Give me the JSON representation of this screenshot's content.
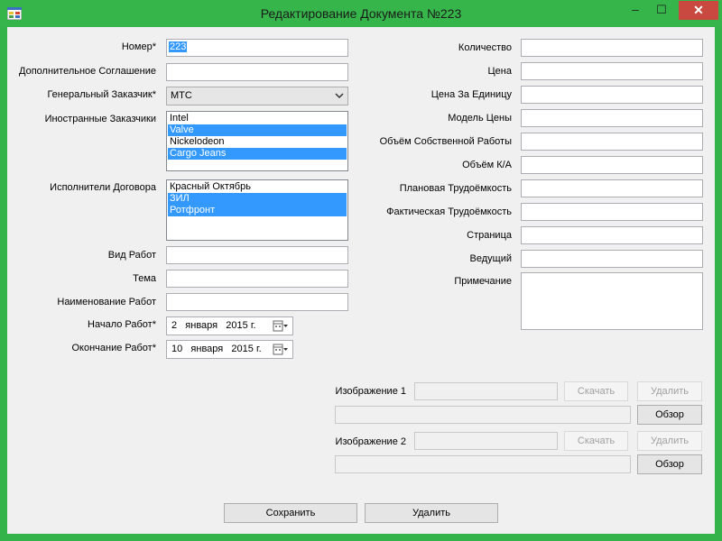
{
  "window": {
    "title": "Редактирование Документа №223",
    "controls": {
      "minimize": "–",
      "maximize": "☐",
      "close": "✕"
    }
  },
  "left_form": {
    "nomer": {
      "label": "Номер*",
      "value": "223"
    },
    "dop_soglashenie": {
      "label": "Дополнительное Соглашение",
      "value": ""
    },
    "gen_zakazchik": {
      "label": "Генеральный Заказчик*",
      "value": "МТС"
    },
    "inostr_zakazchiki": {
      "label": "Иностранные Заказчики",
      "items": [
        {
          "text": "Intel",
          "selected": false
        },
        {
          "text": "Valve",
          "selected": true
        },
        {
          "text": "Nickelodeon",
          "selected": false
        },
        {
          "text": "Cargo Jeans",
          "selected": true
        }
      ]
    },
    "ispolniteli": {
      "label": "Исполнители Договора",
      "items": [
        {
          "text": "Красный Октябрь",
          "selected": false
        },
        {
          "text": "ЗИЛ",
          "selected": true
        },
        {
          "text": "Ротфронт",
          "selected": true
        }
      ]
    },
    "vid_rabot": {
      "label": "Вид Работ",
      "value": ""
    },
    "tema": {
      "label": "Тема",
      "value": ""
    },
    "naimenovanie": {
      "label": "Наименование Работ",
      "value": ""
    },
    "nachalo": {
      "label": "Начало Работ*",
      "day": "2",
      "month": "января",
      "year": "2015 г."
    },
    "okonchanie": {
      "label": "Окончание Работ*",
      "day": "10",
      "month": "января",
      "year": "2015 г."
    }
  },
  "right_form": {
    "kolichestvo": {
      "label": "Количество",
      "value": ""
    },
    "cena": {
      "label": "Цена",
      "value": ""
    },
    "cena_za_edinicu": {
      "label": "Цена За Единицу",
      "value": ""
    },
    "model_ceny": {
      "label": "Модель Цены",
      "value": ""
    },
    "obem_sobstv": {
      "label": "Объём Собственной Работы",
      "value": ""
    },
    "obem_ka": {
      "label": "Объём К/А",
      "value": ""
    },
    "plan_trud": {
      "label": "Плановая Трудоёмкость",
      "value": ""
    },
    "fakt_trud": {
      "label": "Фактическая Трудоёмкость",
      "value": ""
    },
    "stranica": {
      "label": "Страница",
      "value": ""
    },
    "vedushiy": {
      "label": "Ведущий",
      "value": ""
    },
    "primechanie": {
      "label": "Примечание",
      "value": ""
    }
  },
  "images": {
    "image1": {
      "label": "Изображение 1",
      "download": "Скачать",
      "delete": "Удалить",
      "browse": "Обзор"
    },
    "image2": {
      "label": "Изображение 2",
      "download": "Скачать",
      "delete": "Удалить",
      "browse": "Обзор"
    }
  },
  "footer": {
    "save": "Сохранить",
    "delete": "Удалить"
  },
  "colors": {
    "frame": "#36b54a",
    "close": "#c9483f",
    "selection": "#3399ff",
    "client": "#f0f0f0"
  },
  "icons": [
    "app-icon",
    "calendar-icon",
    "chevron-down-icon"
  ]
}
